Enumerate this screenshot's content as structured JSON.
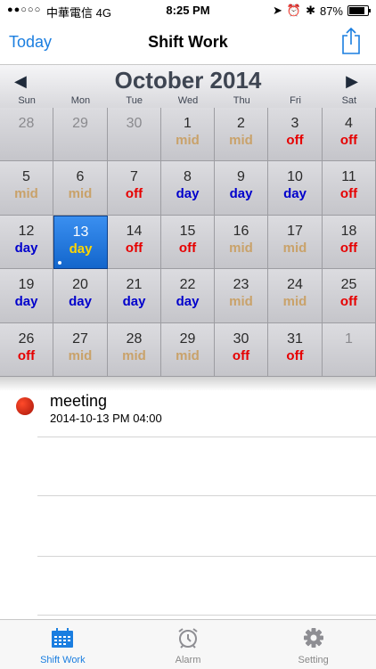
{
  "status": {
    "signal": "●●○○○",
    "carrier": "中華電信  4G",
    "time": "8:25 PM",
    "battery": "87%",
    "battery_level": 0.87
  },
  "nav": {
    "left": "Today",
    "title": "Shift Work"
  },
  "calendar": {
    "month": "October 2014",
    "weekdays": [
      "Sun",
      "Mon",
      "Tue",
      "Wed",
      "Thu",
      "Fri",
      "Sat"
    ],
    "shift_colors": {
      "mid": "#c9a26a",
      "off": "#e60000",
      "day": "#0000cc",
      "selected": "#ffd600"
    },
    "weeks": [
      [
        {
          "d": "28",
          "s": "",
          "o": true
        },
        {
          "d": "29",
          "s": "",
          "o": true
        },
        {
          "d": "30",
          "s": "",
          "o": true
        },
        {
          "d": "1",
          "s": "mid"
        },
        {
          "d": "2",
          "s": "mid"
        },
        {
          "d": "3",
          "s": "off"
        },
        {
          "d": "4",
          "s": "off"
        }
      ],
      [
        {
          "d": "5",
          "s": "mid"
        },
        {
          "d": "6",
          "s": "mid"
        },
        {
          "d": "7",
          "s": "off"
        },
        {
          "d": "8",
          "s": "day"
        },
        {
          "d": "9",
          "s": "day"
        },
        {
          "d": "10",
          "s": "day"
        },
        {
          "d": "11",
          "s": "off"
        }
      ],
      [
        {
          "d": "12",
          "s": "day"
        },
        {
          "d": "13",
          "s": "day",
          "sel": true,
          "dot": true
        },
        {
          "d": "14",
          "s": "off"
        },
        {
          "d": "15",
          "s": "off"
        },
        {
          "d": "16",
          "s": "mid"
        },
        {
          "d": "17",
          "s": "mid"
        },
        {
          "d": "18",
          "s": "off"
        }
      ],
      [
        {
          "d": "19",
          "s": "day"
        },
        {
          "d": "20",
          "s": "day"
        },
        {
          "d": "21",
          "s": "day"
        },
        {
          "d": "22",
          "s": "day"
        },
        {
          "d": "23",
          "s": "mid"
        },
        {
          "d": "24",
          "s": "mid"
        },
        {
          "d": "25",
          "s": "off"
        }
      ],
      [
        {
          "d": "26",
          "s": "off"
        },
        {
          "d": "27",
          "s": "mid"
        },
        {
          "d": "28",
          "s": "mid"
        },
        {
          "d": "29",
          "s": "mid"
        },
        {
          "d": "30",
          "s": "off"
        },
        {
          "d": "31",
          "s": "off"
        },
        {
          "d": "1",
          "s": "",
          "o": true
        }
      ]
    ]
  },
  "event": {
    "title": "meeting",
    "datetime": "2014-10-13 PM 04:00"
  },
  "tabs": [
    {
      "label": "Shift Work",
      "icon": "calendar-icon",
      "active": true
    },
    {
      "label": "Alarm",
      "icon": "alarm-clock-icon",
      "active": false
    },
    {
      "label": "Setting",
      "icon": "gear-icon",
      "active": false
    }
  ]
}
